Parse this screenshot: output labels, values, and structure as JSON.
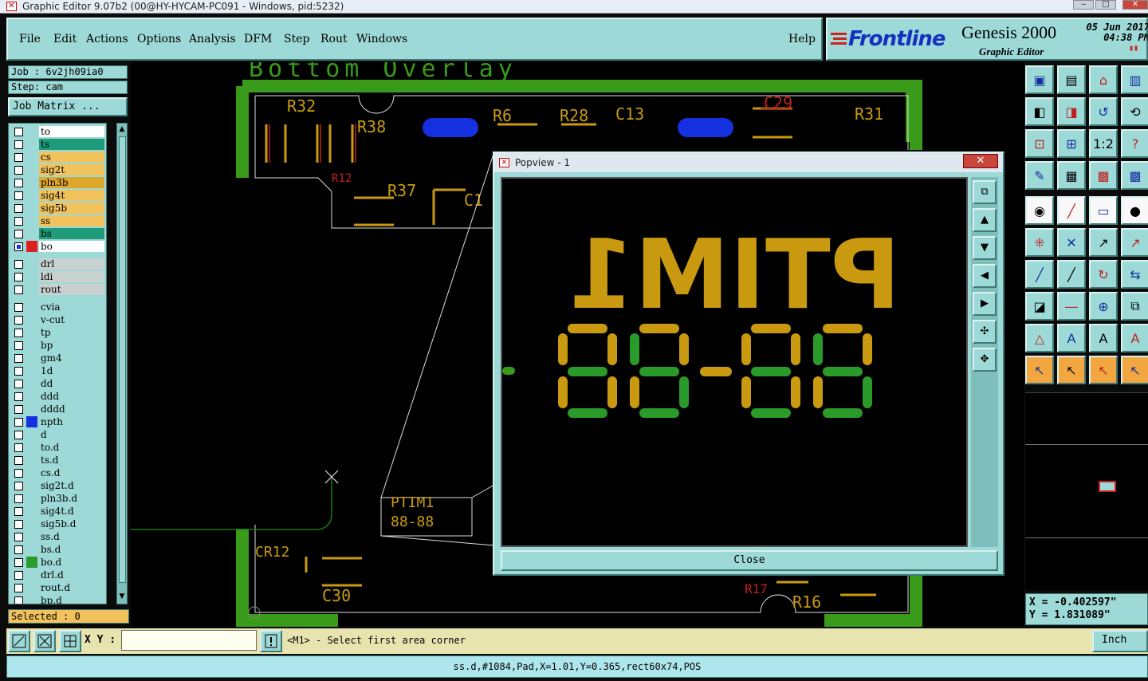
{
  "window": {
    "title": "Graphic Editor 9.07b2 (00@HY-HYCAM-PC091 - Windows, pid:5232)"
  },
  "menu": {
    "items": [
      "File",
      "Edit",
      "Actions",
      "Options",
      "Analysis",
      "DFM",
      "Step",
      "Rout",
      "Windows"
    ],
    "help": "Help"
  },
  "brand": {
    "logo": "Frontline",
    "product": "Genesis 2000",
    "subtitle": "Graphic Editor",
    "date": "05 Jun 2017",
    "time": "04:38 PM"
  },
  "job": {
    "job_label": "Job : 6v2jh09ia0",
    "step_label": "Step: cam",
    "matrix_button": "Job Matrix ..."
  },
  "layers": [
    {
      "name": "to",
      "color": "#ffffff",
      "swatch": ""
    },
    {
      "name": "ts",
      "color": "#1e9b7a",
      "swatch": ""
    },
    {
      "name": "cs",
      "color": "#f2c25c",
      "swatch": ""
    },
    {
      "name": "sig2t",
      "color": "#f2c25c",
      "swatch": ""
    },
    {
      "name": "pln3b",
      "color": "#e0a82a",
      "swatch": ""
    },
    {
      "name": "sig4t",
      "color": "#f2c25c",
      "swatch": ""
    },
    {
      "name": "sig5b",
      "color": "#f2c25c",
      "swatch": ""
    },
    {
      "name": "ss",
      "color": "#f2c25c",
      "swatch": ""
    },
    {
      "name": "bs",
      "color": "#1e9b7a",
      "swatch": ""
    },
    {
      "name": "bo",
      "color": "#ffffff",
      "swatch": "#e02020",
      "active": true
    },
    {
      "name": "drl",
      "color": "#c8d0d0",
      "swatch": ""
    },
    {
      "name": "ldi",
      "color": "#c8d0d0",
      "swatch": ""
    },
    {
      "name": "rout",
      "color": "#c8d0d0",
      "swatch": ""
    },
    {
      "name": "cvia",
      "color": "#9dd9d6",
      "swatch": ""
    },
    {
      "name": "v-cut",
      "color": "#9dd9d6",
      "swatch": ""
    },
    {
      "name": "tp",
      "color": "#9dd9d6",
      "swatch": ""
    },
    {
      "name": "bp",
      "color": "#9dd9d6",
      "swatch": ""
    },
    {
      "name": "gm4",
      "color": "#9dd9d6",
      "swatch": ""
    },
    {
      "name": "1d",
      "color": "#9dd9d6",
      "swatch": ""
    },
    {
      "name": "dd",
      "color": "#9dd9d6",
      "swatch": ""
    },
    {
      "name": "ddd",
      "color": "#9dd9d6",
      "swatch": ""
    },
    {
      "name": "dddd",
      "color": "#9dd9d6",
      "swatch": ""
    },
    {
      "name": "npth",
      "color": "#9dd9d6",
      "swatch": "#1530e0"
    },
    {
      "name": "d",
      "color": "#9dd9d6",
      "swatch": ""
    },
    {
      "name": "to.d",
      "color": "#9dd9d6",
      "swatch": ""
    },
    {
      "name": "ts.d",
      "color": "#9dd9d6",
      "swatch": ""
    },
    {
      "name": "cs.d",
      "color": "#9dd9d6",
      "swatch": ""
    },
    {
      "name": "sig2t.d",
      "color": "#9dd9d6",
      "swatch": ""
    },
    {
      "name": "pln3b.d",
      "color": "#9dd9d6",
      "swatch": ""
    },
    {
      "name": "sig4t.d",
      "color": "#9dd9d6",
      "swatch": ""
    },
    {
      "name": "sig5b.d",
      "color": "#9dd9d6",
      "swatch": ""
    },
    {
      "name": "ss.d",
      "color": "#9dd9d6",
      "swatch": ""
    },
    {
      "name": "bs.d",
      "color": "#9dd9d6",
      "swatch": ""
    },
    {
      "name": "bo.d",
      "color": "#9dd9d6",
      "swatch": "#2a9a2a"
    },
    {
      "name": "drl.d",
      "color": "#9dd9d6",
      "swatch": ""
    },
    {
      "name": "rout.d",
      "color": "#9dd9d6",
      "swatch": ""
    },
    {
      "name": "bp.d",
      "color": "#9dd9d6",
      "swatch": ""
    }
  ],
  "selected_label": "Selected : 0",
  "canvas": {
    "layer_title": "Bottom Overlay",
    "refdes": [
      "R32",
      "R38",
      "R6",
      "R28",
      "C13",
      "C29",
      "R31",
      "R37",
      "C1",
      "R12",
      "C30",
      "R16",
      "CR12",
      "R17"
    ],
    "mini_marking_1": "PTIM1",
    "mini_marking_2": "88-88"
  },
  "popview": {
    "title": "Popview - 1",
    "marking_1": "PTIM1",
    "marking_2": "88-88",
    "close_label": "Close",
    "close_x": "✕"
  },
  "coords": {
    "x": "X = -0.402597\"",
    "y": "Y = 1.831089\""
  },
  "statusbar": {
    "xy_label": "X Y :",
    "xy_value": "",
    "prompt": "<M1> - Select first area corner",
    "units": "Inch"
  },
  "infobar": "ss.d,#1084,Pad,X=1.01,Y=0.365,rect60x74,POS",
  "colors": {
    "panel": "#9dd9d6",
    "silk_yellow": "#c99a10",
    "silk_green": "#2a9a2a",
    "pad_blue": "#1530e0",
    "board_green": "#3a9a1a"
  }
}
